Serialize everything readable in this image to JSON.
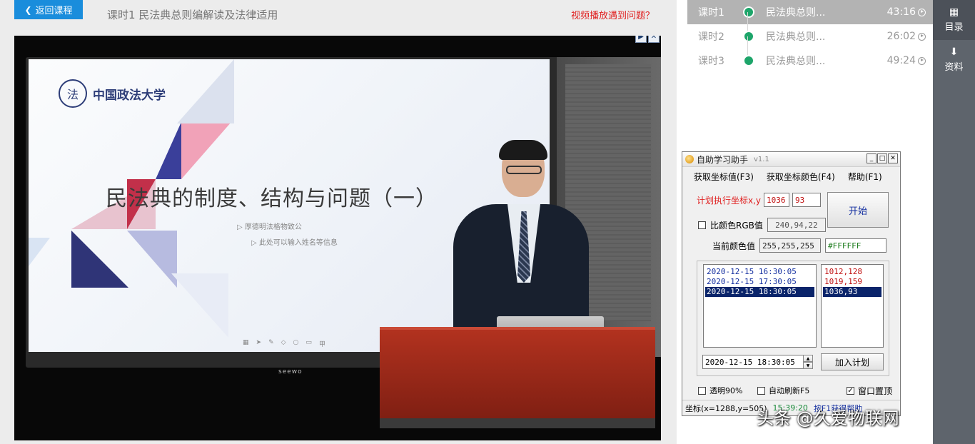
{
  "header": {
    "back_label": "返回课程",
    "lesson_title": "课时1  民法典总则编解读及法律适用",
    "problem_link": "视频播放遇到问题？"
  },
  "slide": {
    "logo_text": "中国政法大学",
    "logo_badge": "法",
    "title": "民法典的制度、结构与问题（一）",
    "sub1": "厚德明法格物致公",
    "sub2": "此处可以输入姓名等信息",
    "brand": "seewo"
  },
  "chapters": [
    {
      "no": "课时1",
      "name": "民法典总则...",
      "time": "43:16",
      "active": true
    },
    {
      "no": "课时2",
      "name": "民法典总则...",
      "time": "26:02",
      "active": false
    },
    {
      "no": "课时3",
      "name": "民法典总则...",
      "time": "49:24",
      "active": false
    }
  ],
  "sidebar": {
    "catalog": "目录",
    "materials": "资料"
  },
  "helper": {
    "title": "自助学习助手",
    "version": "v1.1",
    "menu": [
      "获取坐标值(F3)",
      "获取坐标颜色(F4)",
      "帮助(F1)"
    ],
    "coord_label": "计划执行坐标x,y",
    "coord_x": "1036",
    "coord_y": "93",
    "start_button": "开始",
    "compare_label": "比颜色RGB值",
    "compare_value": "240,94,22",
    "current_color_label": "当前颜色值",
    "current_color_value": "255,255,255",
    "hex_color": "#FFFFFF",
    "times": [
      "2020-12-15 16:30:05",
      "2020-12-15 17:30:05",
      "2020-12-15 18:30:05"
    ],
    "coords": [
      "1012,128",
      "1019,159",
      "1036,93"
    ],
    "datetime_value": "2020-12-15 18:30:05",
    "add_plan_button": "加入计划",
    "transparent_label": "透明90%",
    "auto_refresh_label": "自动刷新F5",
    "topmost_label": "窗口置顶",
    "status_coords": "坐标(x=1288,y=505)",
    "status_time": "15:39:20",
    "status_help": "按F1获得帮助"
  },
  "watermark": "头条 @久爱物联网",
  "colors": {
    "accent": "#1a8ddc",
    "warning": "#e02020",
    "progress_dot": "#1da56a",
    "selection": "#0a246a",
    "sidebar": "#5e646c"
  }
}
